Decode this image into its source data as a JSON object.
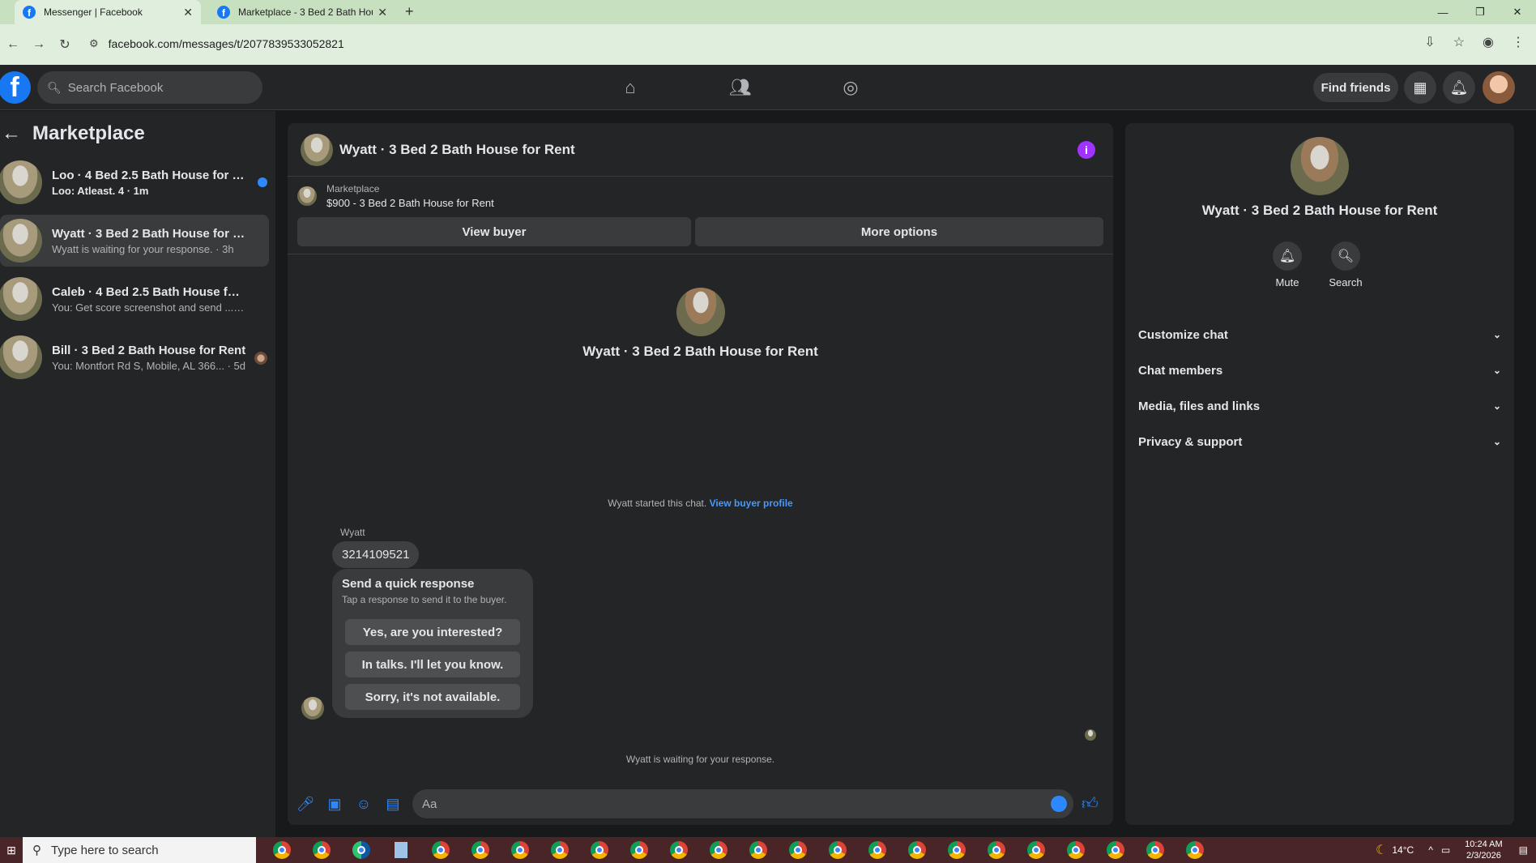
{
  "browser": {
    "tabs": [
      {
        "title": "Messenger | Facebook",
        "active": true
      },
      {
        "title": "Marketplace - 3 Bed 2 Bath Hou",
        "active": false
      }
    ],
    "url": "facebook.com/messages/t/2077839533052821"
  },
  "fb_header": {
    "logo": "f",
    "search_placeholder": "Search Facebook",
    "find_friends": "Find friends"
  },
  "sidebar": {
    "title": "Marketplace",
    "conversations": [
      {
        "name": "Loo · 4 Bed 2.5 Bath House for R...",
        "preview": "Loo: Atleast. 4 · 1m",
        "unread": true
      },
      {
        "name": "Wyatt · 3 Bed 2 Bath House for Rent",
        "preview": "Wyatt is waiting for your response. · 3h",
        "active": true
      },
      {
        "name": "Caleb · 4 Bed 2.5 Bath House for R...",
        "preview": "You: Get score screenshot and send ... · 22h"
      },
      {
        "name": "Bill · 3 Bed 2 Bath House for Rent",
        "preview": "You: Montfort Rd S, Mobile, AL 366... · 5d"
      }
    ]
  },
  "chat": {
    "title": "Wyatt · 3 Bed 2 Bath House for Rent",
    "listing_source": "Marketplace",
    "listing_detail": "$900 - 3 Bed 2 Bath House for Rent",
    "view_buyer": "View buyer",
    "more_options": "More options",
    "profile_name": "Wyatt · 3 Bed 2 Bath House for Rent",
    "started_text": "Wyatt started this chat.",
    "view_buyer_profile": "View buyer profile",
    "sender": "Wyatt",
    "message": "3214109521",
    "quick_response": {
      "title": "Send a quick response",
      "subtitle": "Tap a response to send it to the buyer.",
      "options": [
        "Yes, are you interested?",
        "In talks. I'll let you know.",
        "Sorry, it's not available."
      ]
    },
    "waiting": "Wyatt is waiting for your response.",
    "composer_placeholder": "Aa"
  },
  "right_panel": {
    "name": "Wyatt · 3 Bed 2 Bath House for Rent",
    "actions": [
      {
        "label": "Mute",
        "icon": "bell-icon"
      },
      {
        "label": "Search",
        "icon": "search-icon"
      }
    ],
    "sections": [
      "Customize chat",
      "Chat members",
      "Media, files and links",
      "Privacy & support"
    ]
  },
  "taskbar": {
    "search_placeholder": "Type here to search",
    "temperature": "14°C",
    "time": "10:24 AM",
    "date": "2/3/2026"
  },
  "colors": {
    "accent": "#2d88ff",
    "info_badge": "#a033ff",
    "background": "#18191a",
    "panel": "#242526"
  }
}
